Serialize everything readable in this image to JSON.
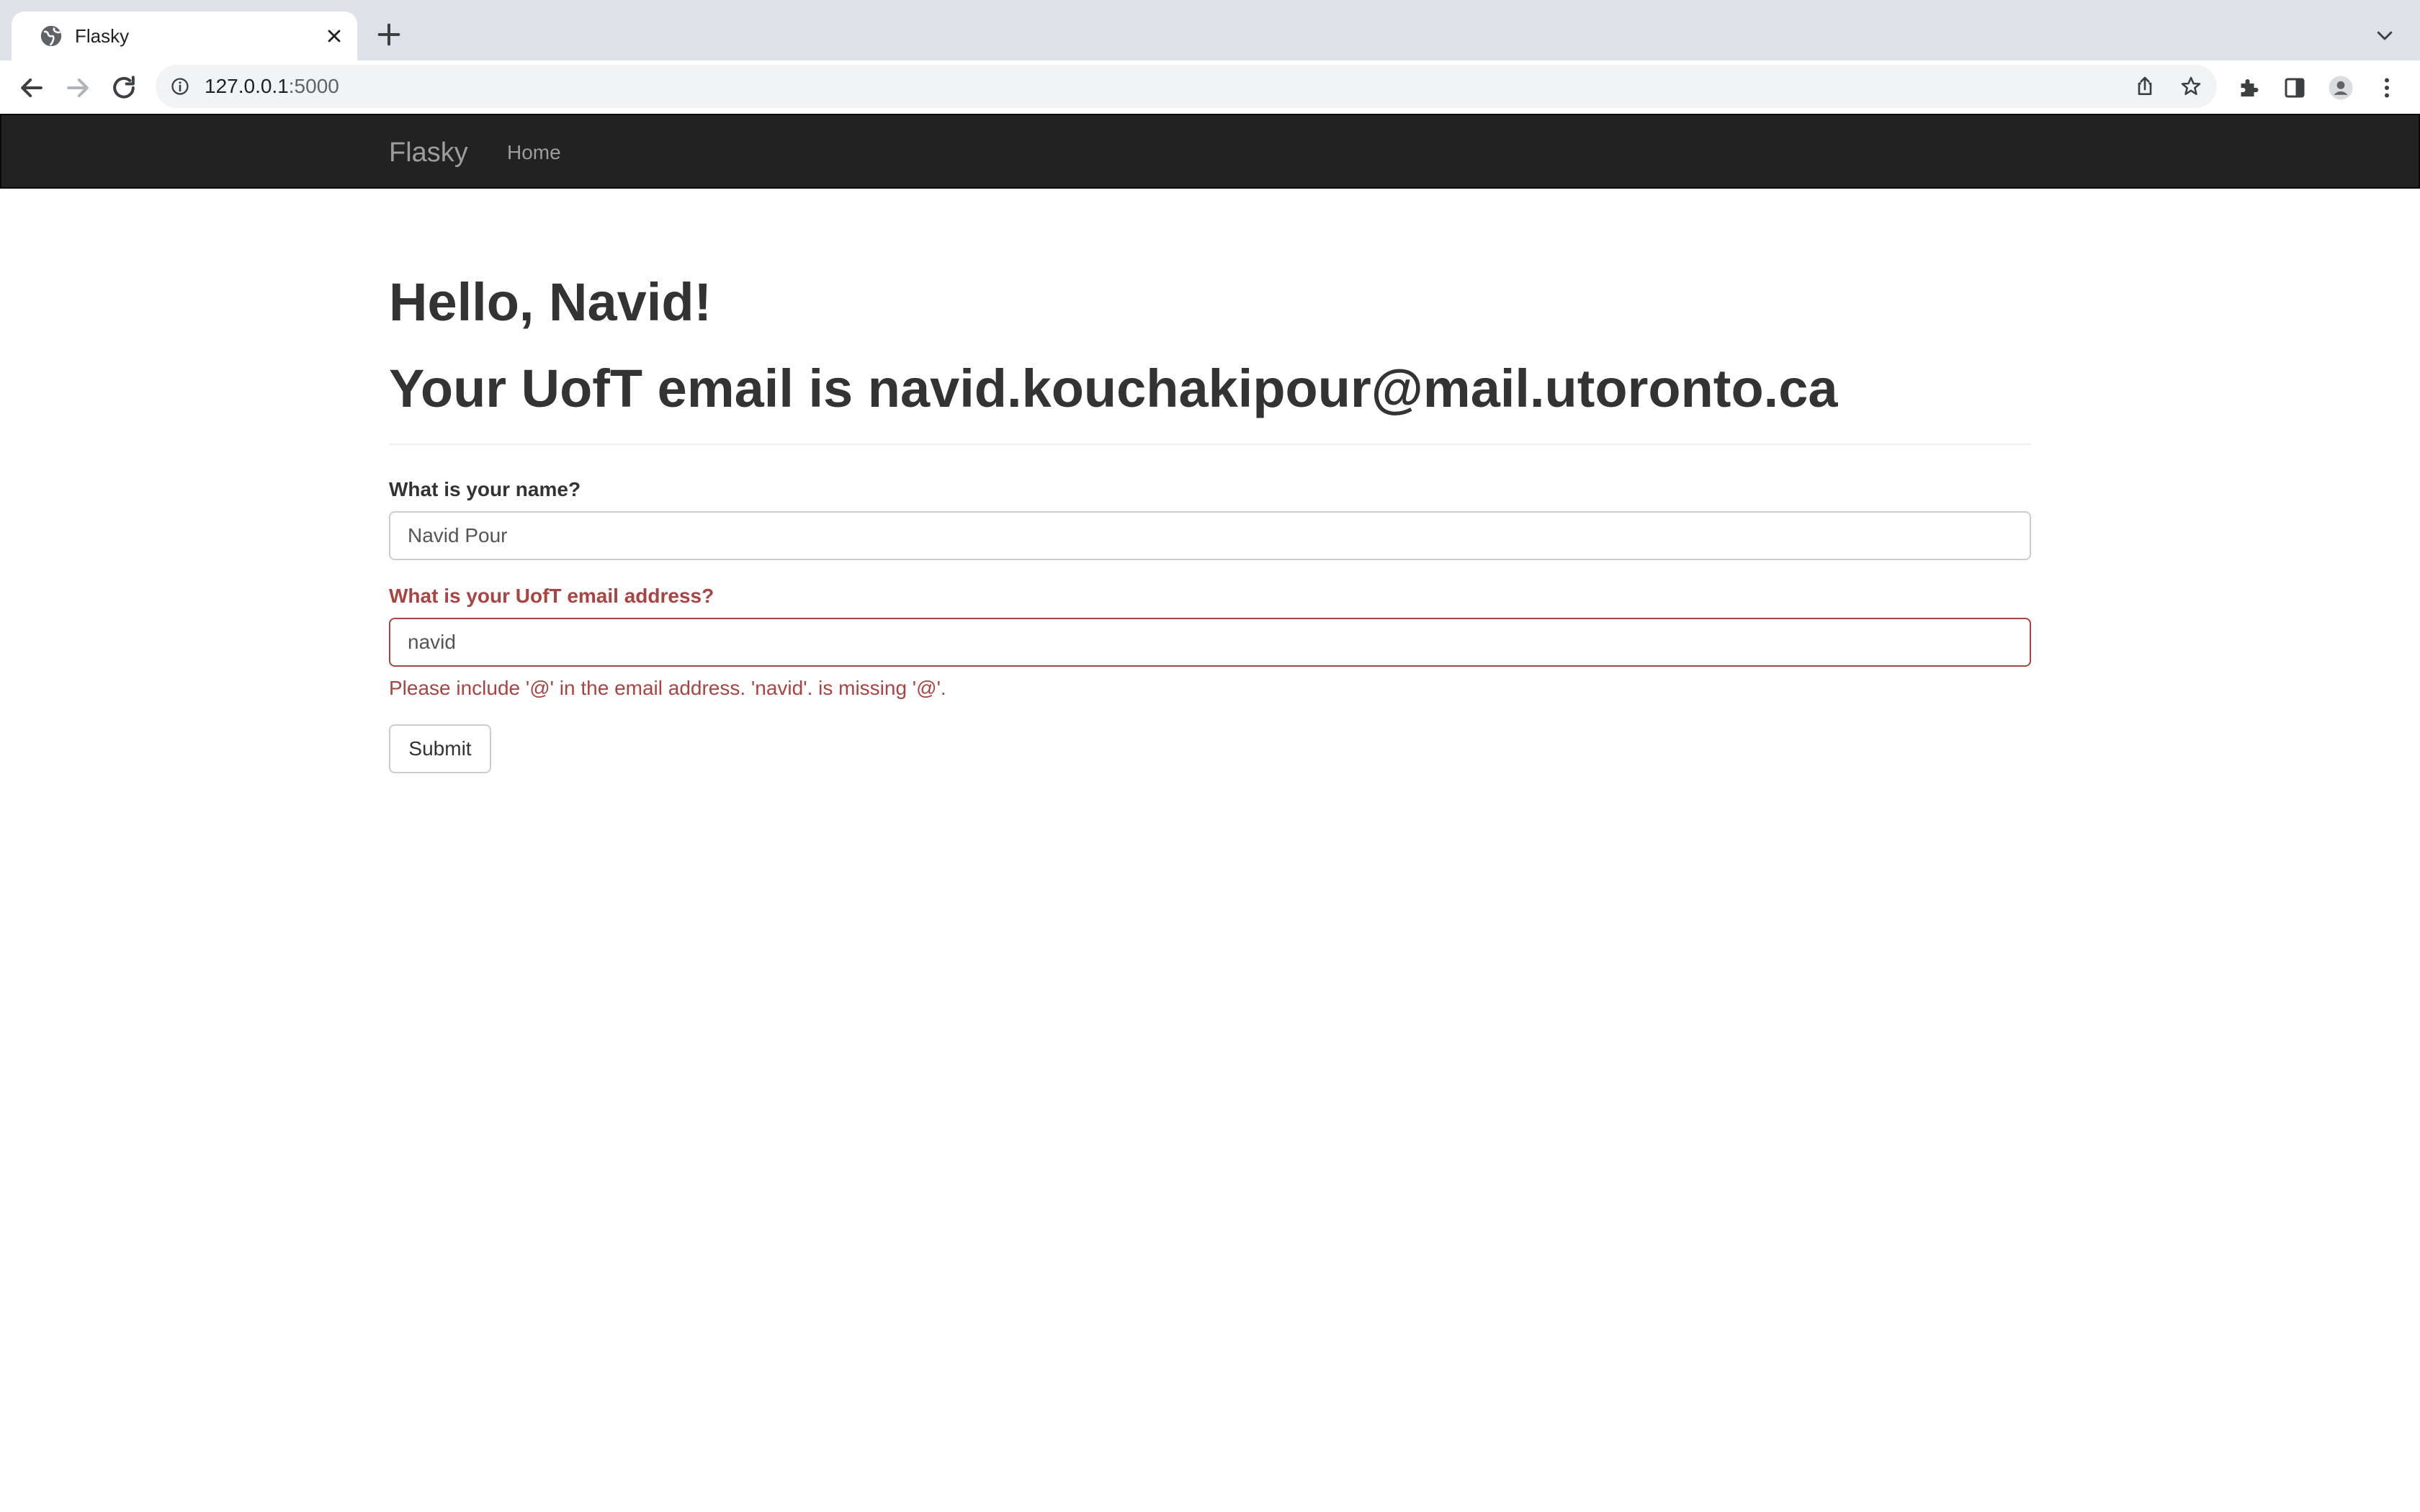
{
  "browser": {
    "tab": {
      "title": "Flasky",
      "favicon": "globe-icon"
    },
    "address": {
      "host": "127.0.0.1",
      "port": ":5000"
    },
    "icons": [
      "back-icon",
      "forward-icon",
      "reload-icon",
      "info-icon",
      "share-icon",
      "star-icon",
      "extensions-icon",
      "side-panel-icon",
      "profile-icon",
      "menu-icon",
      "new-tab-icon",
      "tab-list-icon",
      "close-icon"
    ]
  },
  "navbar": {
    "brand": "Flasky",
    "links": [
      {
        "label": "Home"
      }
    ]
  },
  "main": {
    "greeting": "Hello, Navid!",
    "email_heading": "Your UofT email is navid.kouchakipour@mail.utoronto.ca"
  },
  "form": {
    "name_label": "What is your name?",
    "name_value": "Navid Pour",
    "email_label": "What is your UofT email address?",
    "email_value": "navid",
    "email_error": "Please include '@' in the email address. 'navid'. is missing '@'.",
    "submit_label": "Submit"
  },
  "colors": {
    "navbar_bg": "#222222",
    "navbar_text": "#9d9d9d",
    "error": "#a94442",
    "heading": "#333333"
  }
}
